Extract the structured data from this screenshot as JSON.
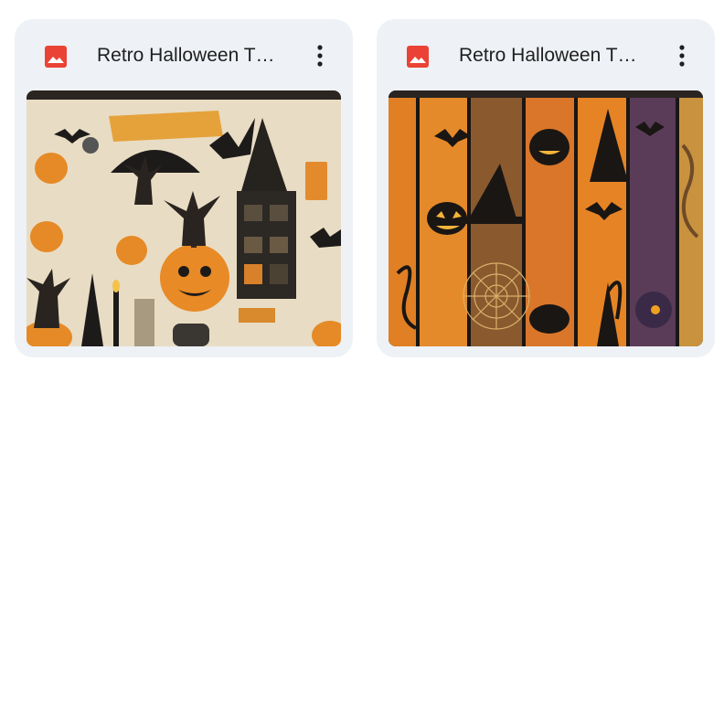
{
  "files": [
    {
      "title": "Retro Halloween T…",
      "type_icon": "image-file-icon",
      "menu_icon": "more-vert-icon",
      "thumbnail": "halloween-collage-thumbnail"
    },
    {
      "title": "Retro Halloween T…",
      "type_icon": "image-file-icon",
      "menu_icon": "more-vert-icon",
      "thumbnail": "halloween-stripes-thumbnail"
    }
  ],
  "colors": {
    "card_bg": "#eef1f6",
    "image_icon_red": "#ea4335",
    "title_text": "#1f1f1f"
  }
}
